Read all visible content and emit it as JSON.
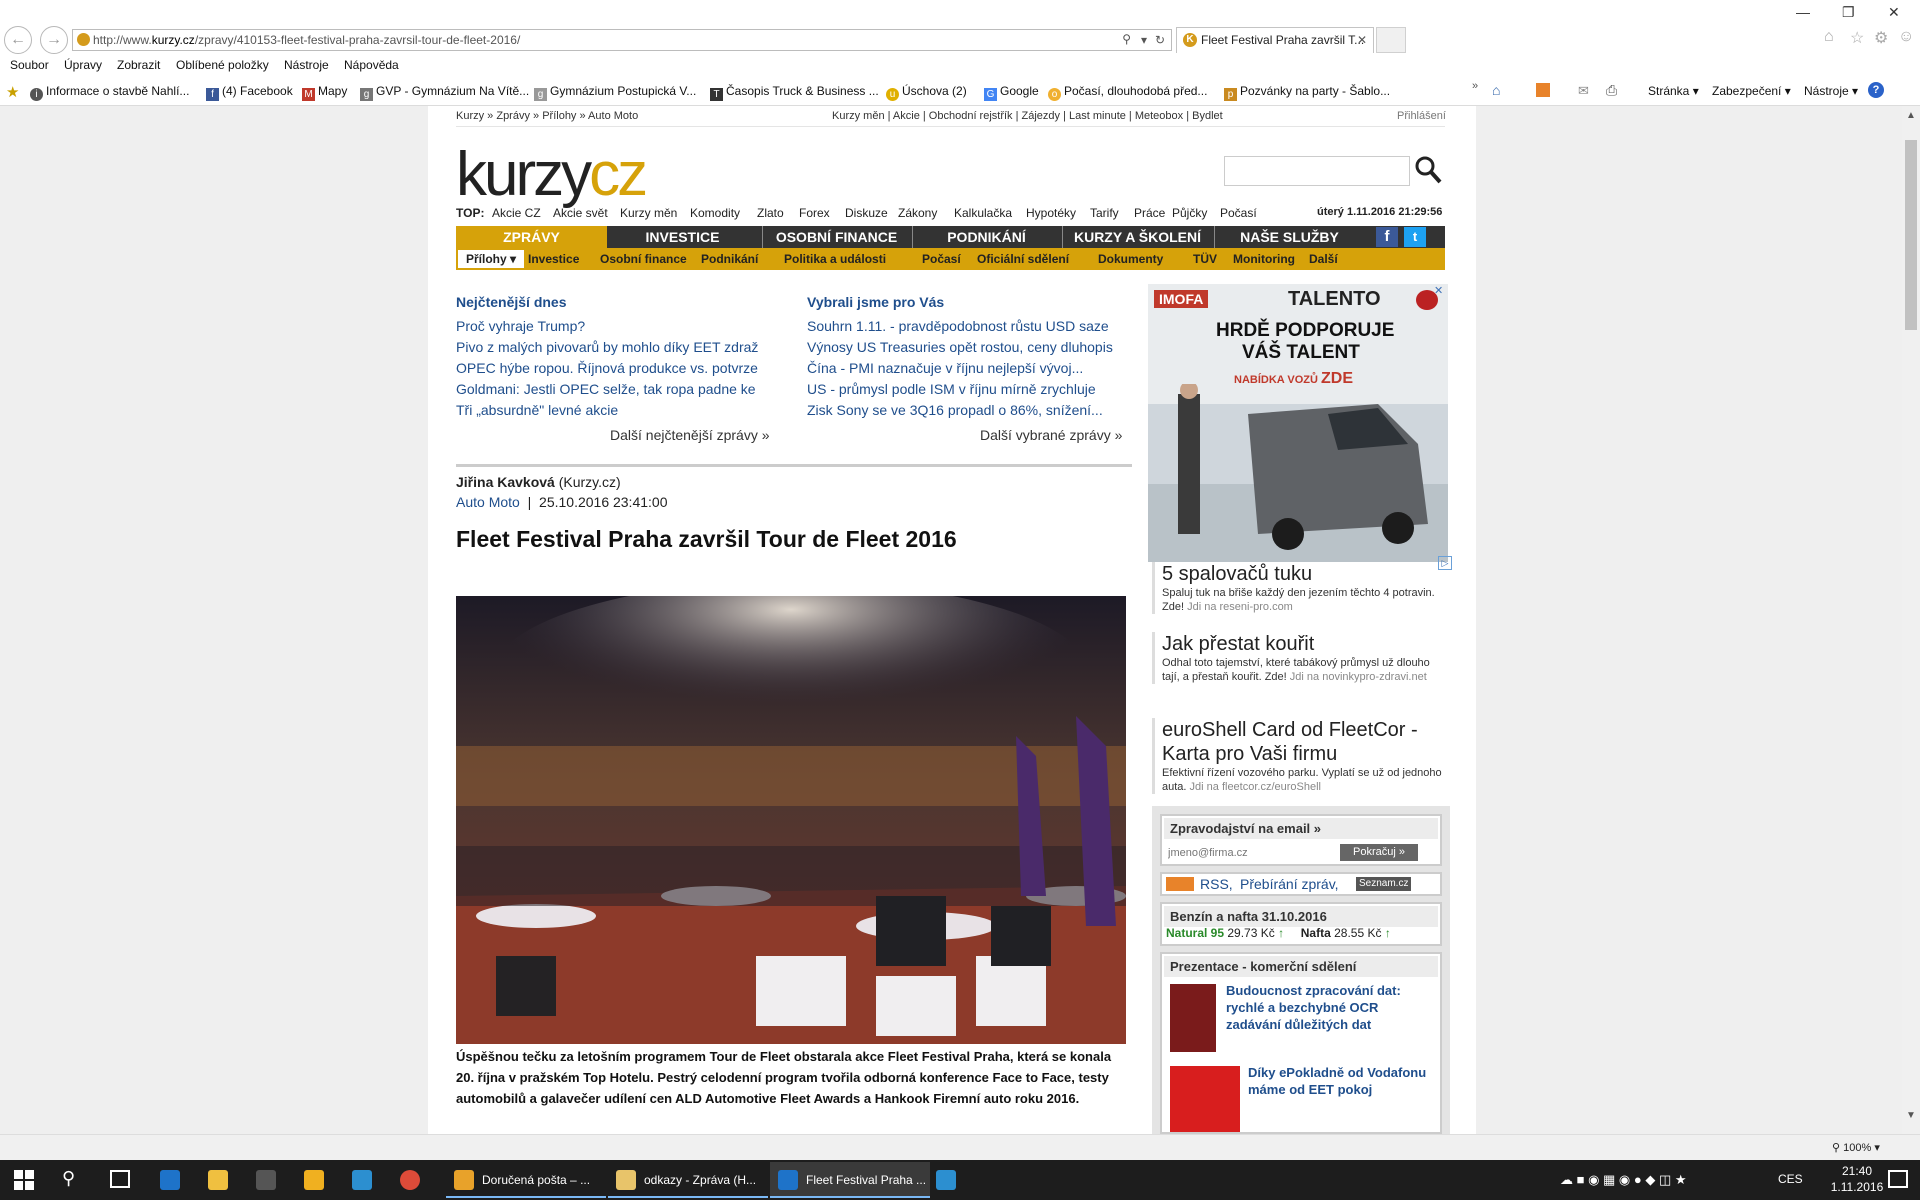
{
  "browser": {
    "url_prefix": "http://www.",
    "url_domain": "kurzy.cz",
    "url_path": "/zpravy/410153-fleet-festival-praha-zavrsil-tour-de-fleet-2016/",
    "tab_title": "Fleet Festival Praha završil T...",
    "tab_favicon": "K",
    "menu": [
      "Soubor",
      "Úpravy",
      "Zobrazit",
      "Oblíbené položky",
      "Nástroje",
      "Nápověda"
    ],
    "favorites": [
      "Informace o stavbě  Nahlí...",
      "(4) Facebook",
      "Mapy",
      "GVP - Gymnázium Na Vítě...",
      "Gymnázium Postupická  V...",
      "Časopis Truck & Business ...",
      "Úschova (2)",
      "Google",
      "Počasí, dlouhodobá před...",
      "Pozvánky na party - Šablo..."
    ],
    "command_bar": [
      "Stránka",
      "Zabezpečení",
      "Nástroje"
    ],
    "zoom": "100%"
  },
  "site": {
    "breadcrumb": "Kurzy » Zprávy » Přílohy » Auto Moto",
    "toplinks": "Kurzy měn | Akcie | Obchodní rejstřík | Zájezdy | Last minute | Meteobox | Bydlet",
    "login": "Přihlášení",
    "logo_a": "kurzy",
    "logo_b": "cz",
    "top_label": "TOP:",
    "top_items": [
      "Akcie CZ",
      "Akcie svět",
      "Kurzy měn",
      "Komodity",
      "Zlato",
      "Forex",
      "Diskuze",
      "Zákony",
      "Kalkulačka",
      "Hypotéky",
      "Tarify",
      "Práce",
      "Půjčky",
      "Počasí"
    ],
    "datetime": "úterý 1.11.2016 21:29:56",
    "main_nav": [
      "ZPRÁVY",
      "INVESTICE",
      "OSOBNÍ FINANCE",
      "PODNIKÁNÍ",
      "KURZY A ŠKOLENÍ",
      "NAŠE SLUŽBY"
    ],
    "sub_nav": [
      "Přílohy ▾",
      "Investice",
      "Osobní finance",
      "Podnikání",
      "Politika a události",
      "Počasí",
      "Oficiální sdělení",
      "Dokumenty",
      "TÜV",
      "Monitoring",
      "Další"
    ]
  },
  "most_read": {
    "title": "Nejčtenější dnes",
    "items": [
      "Proč vyhraje Trump?",
      "Pivo z malých pivovarů by mohlo díky EET zdraž",
      "OPEC hýbe ropou. Říjnová produkce vs. potvrze",
      "Goldmani: Jestli OPEC selže, tak ropa padne ke",
      "Tři „absurdně\" levné akcie"
    ],
    "more": "Další nejčtenější zprávy »"
  },
  "picked": {
    "title": "Vybrali jsme pro Vás",
    "items": [
      "Souhrn 1.11. - pravděpodobnost růstu USD saze",
      "Výnosy US Treasuries opět rostou, ceny dluhopis",
      "Čína - PMI naznačuje v říjnu nejlepší vývoj...",
      "US - průmysl podle ISM v říjnu mírně zrychluje",
      "Zisk Sony se ve 3Q16 propadl o 86%, snížení..."
    ],
    "more": "Další vybrané zprávy »"
  },
  "article": {
    "author": "Jiřina Kavková",
    "source": "(Kurzy.cz)",
    "category": "Auto Moto",
    "date": "25.10.2016 23:41:00",
    "headline": "Fleet Festival Praha završil Tour de Fleet 2016",
    "caption": "Úspěšnou tečku za letošním programem Tour de Fleet obstarala akce Fleet Festival Praha, která se konala 20. října v pražském Top Hotelu. Pestrý celodenní program tvořila odborná konference Face to Face, testy automobilů a galavečer udílení cen ALD Automotive Fleet Awards a Hankook Firemní auto roku 2016."
  },
  "banner": {
    "brand": "IMOFA",
    "talent": "TALENTO",
    "line1": "HRDĚ PODPORUJE",
    "line2": "VÁŠ TALENT",
    "cta_a": "NABÍDKA VOZŮ",
    "cta_b": "ZDE"
  },
  "text_ads": [
    {
      "title": "5 spalovačů tuku",
      "desc": "Spaluj tuk na břiše každý den jezením těchto 4 potravin. Zde!",
      "url": "Jdi na reseni-pro.com"
    },
    {
      "title": "Jak přestat kouřit",
      "desc": "Odhal toto tajemství, které tabákový průmysl už dlouho tají, a přestaň kouřit. Zde!",
      "url": "Jdi na novinkypro-zdravi.net"
    },
    {
      "title": "euroShell Card od FleetCor - Karta pro Vaši firmu",
      "desc": "Efektivní řízení vozového parku. Vyplatí se už od jednoho auta.",
      "url": "Jdi na fleetcor.cz/euroShell"
    }
  ],
  "newsletter": {
    "title": "Zpravodajství na email »",
    "placeholder": "jmeno@firma.cz",
    "button": "Pokračuj »"
  },
  "rss": {
    "label": "RSS,",
    "label2": "Přebírání zpráv,",
    "seznam": "Seznam.cz"
  },
  "fuel": {
    "title": "Benzín a nafta 31.10.2016",
    "natural_label": "Natural 95",
    "natural_price": "29.73 Kč",
    "diesel_label": "Nafta",
    "diesel_price": "28.55 Kč"
  },
  "promo": {
    "title": "Prezentace - komerční sdělení",
    "items": [
      "Budoucnost zpracování dat: rychlé a bezchybné OCR zadávání důležitých dat",
      "Díky ePokladně od Vodafonu máme od EET pokoj"
    ]
  },
  "taskbar": {
    "items": [
      "Doručená pošta – ...",
      "odkazy - Zpráva (H...",
      "Fleet Festival Praha ..."
    ],
    "lang": "CES",
    "time": "21:40",
    "date": "1.11.2016"
  },
  "colors": {
    "accent": "#d6a20a",
    "link": "#1f4e8c",
    "nav_dark": "#333333"
  }
}
